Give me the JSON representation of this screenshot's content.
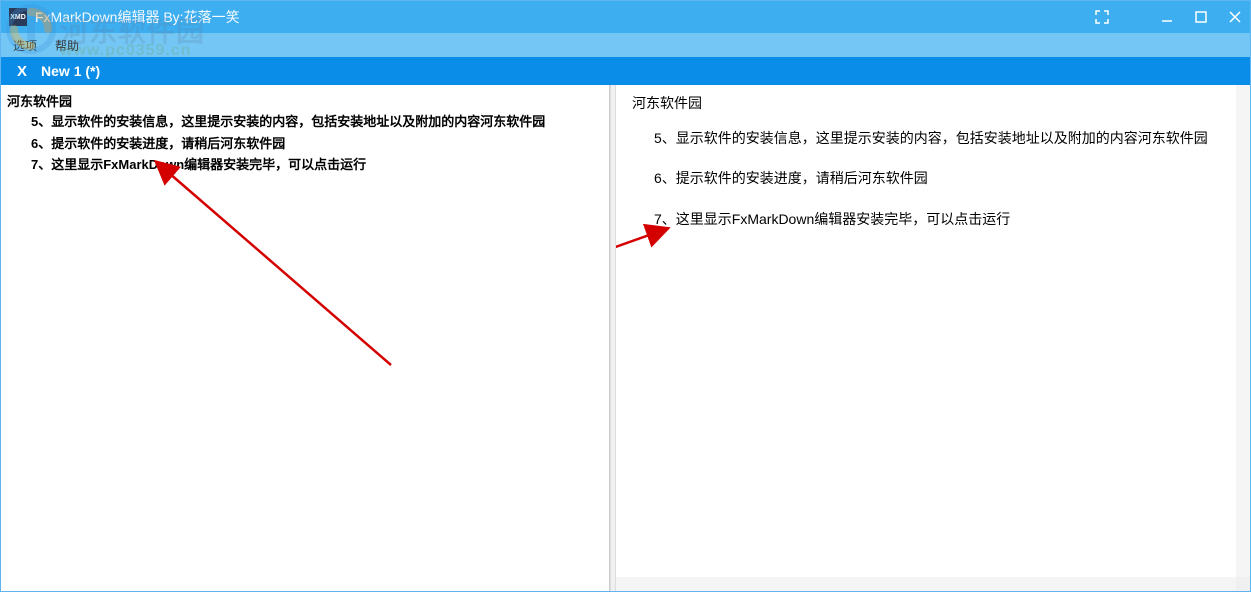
{
  "window": {
    "title": "FxMarkDown编辑器  By:花落一笑",
    "app_icon_text": "XMD"
  },
  "watermark": {
    "text": "河东软件园",
    "url": "www.pc0359.cn"
  },
  "menu": {
    "options": "选项",
    "help": "帮助"
  },
  "tab": {
    "close": "X",
    "label": "New 1 (*)"
  },
  "editor": {
    "heading": "河东软件园",
    "line5": "5、显示软件的安装信息，这里提示安装的内容，包括安装地址以及附加的内容河东软件园",
    "line6": "6、提示软件的安装进度，请稍后河东软件园",
    "line7": "7、这里显示FxMarkDown编辑器安装完毕，可以点击运行"
  },
  "preview": {
    "heading": "河东软件园",
    "item5": "5、显示软件的安装信息，这里提示安装的内容，包括安装地址以及附加的内容河东软件园",
    "item6": "6、提示软件的安装进度，请稍后河东软件园",
    "item7": "7、这里显示FxMarkDown编辑器安装完毕，可以点击运行"
  }
}
